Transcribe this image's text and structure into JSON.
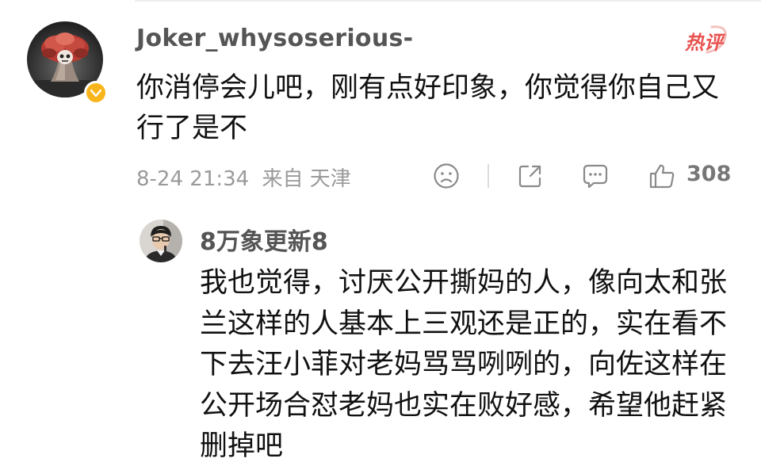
{
  "main_comment": {
    "username": "Joker_whysoserious-",
    "hot_label": "热评",
    "text": "你消停会儿吧，刚有点好印象，你觉得你自己又行了是不",
    "timestamp": "8-24 21:34",
    "location": "来自 天津",
    "like_count": "308",
    "colors": {
      "verified": "#f8b51b",
      "hot": "#e8524f"
    }
  },
  "reply": {
    "username": "8万象更新8",
    "text": "我也觉得，讨厌公开撕妈的人，像向太和张兰这样的人基本上三观还是正的，实在看不下去汪小菲对老妈骂骂咧咧的，向佐这样在公开场合怼老妈也实在败好感，希望他赶紧删掉吧"
  },
  "actions": [
    "sad-face-icon",
    "share-icon",
    "comment-icon",
    "thumbs-up-icon"
  ]
}
